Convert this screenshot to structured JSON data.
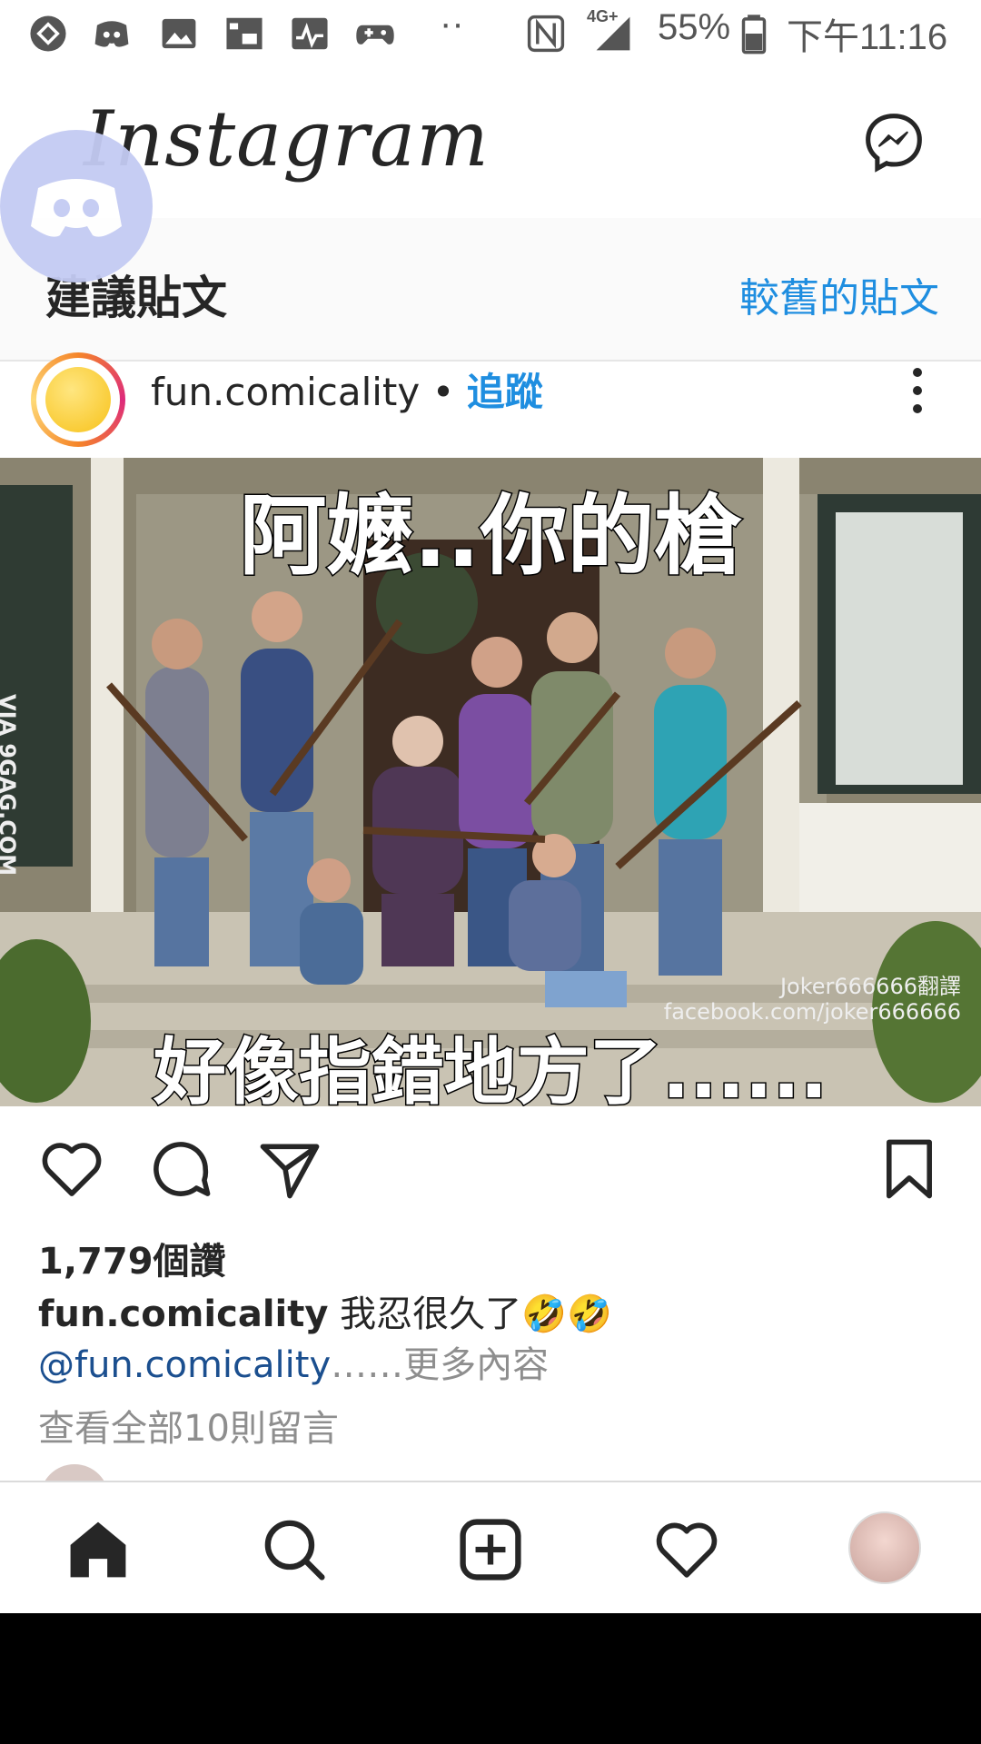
{
  "status_bar": {
    "battery": "55%",
    "network": "4G+",
    "time": "下午11:16",
    "icons": [
      "app-icon",
      "discord-icon",
      "image-icon",
      "picture-icon",
      "activity-icon",
      "gamepad-icon",
      "more-dots-icon",
      "nfc-icon",
      "signal-icon",
      "battery-icon"
    ]
  },
  "header": {
    "logo": "Instagram",
    "messenger_icon": "messenger-icon"
  },
  "suggested": {
    "title": "建議貼文",
    "older_link": "較舊的貼文"
  },
  "post": {
    "username": "fun.comicality",
    "separator": "•",
    "follow_label": "追蹤",
    "image": {
      "caption_top": "阿嬤..你的槍",
      "caption_bottom": "好像指錯地方了......",
      "watermark_side": "VIA 9GAG.COM",
      "watermark_credit_1": "Joker666666翻譯",
      "watermark_credit_2": "facebook.com/joker666666"
    },
    "likes": "1,779個讚",
    "caption_user": "fun.comicality",
    "caption_text": "我忍很久了🤣🤣",
    "mention": "@fun.comicality",
    "more_label": "……更多內容",
    "view_comments": "查看全部10則留言"
  },
  "nav": {
    "items": [
      "home-icon",
      "search-icon",
      "add-icon",
      "heart-icon",
      "profile-avatar"
    ]
  }
}
